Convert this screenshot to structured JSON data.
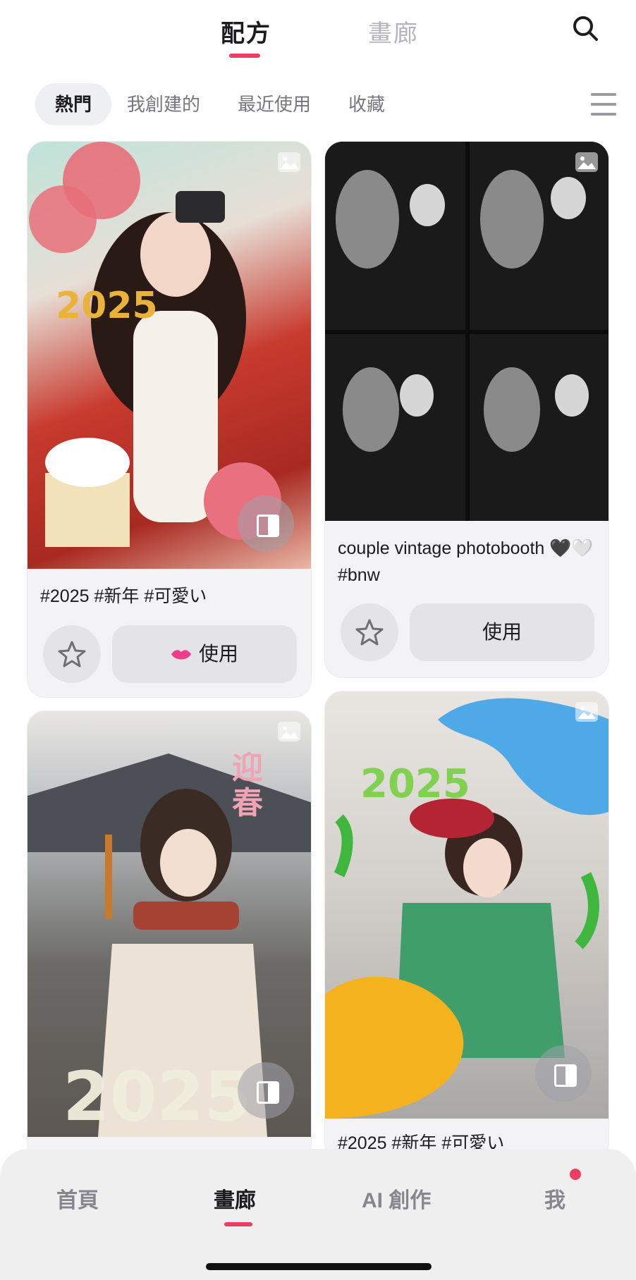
{
  "header": {
    "tabs": [
      {
        "label": "配方",
        "active": true
      },
      {
        "label": "畫廊",
        "active": false
      }
    ],
    "search_icon": "search-icon"
  },
  "filters": {
    "chips": [
      {
        "label": "熱門",
        "active": true
      },
      {
        "label": "我創建的",
        "active": false
      },
      {
        "label": "最近使用",
        "active": false
      },
      {
        "label": "收藏",
        "active": false
      }
    ],
    "menu_icon": "menu-icon"
  },
  "cards": [
    {
      "caption": "#2025 #新年 #可愛い",
      "use_label": "使用",
      "has_heart": true
    },
    {
      "caption": "couple vintage photobooth 🖤🤍 #bnw",
      "use_label": "使用",
      "has_heart": false
    },
    {
      "caption": "",
      "use_label": "",
      "has_heart": false
    },
    {
      "caption": "#2025 #新年 #可愛い",
      "use_label": "",
      "has_heart": false
    }
  ],
  "bottom_nav": {
    "items": [
      {
        "label": "首頁",
        "active": false
      },
      {
        "label": "畫廊",
        "active": true
      },
      {
        "label": "AI 創作",
        "active": false
      },
      {
        "label": "我",
        "active": false
      }
    ]
  },
  "colors": {
    "accent": "#ee3d64"
  }
}
